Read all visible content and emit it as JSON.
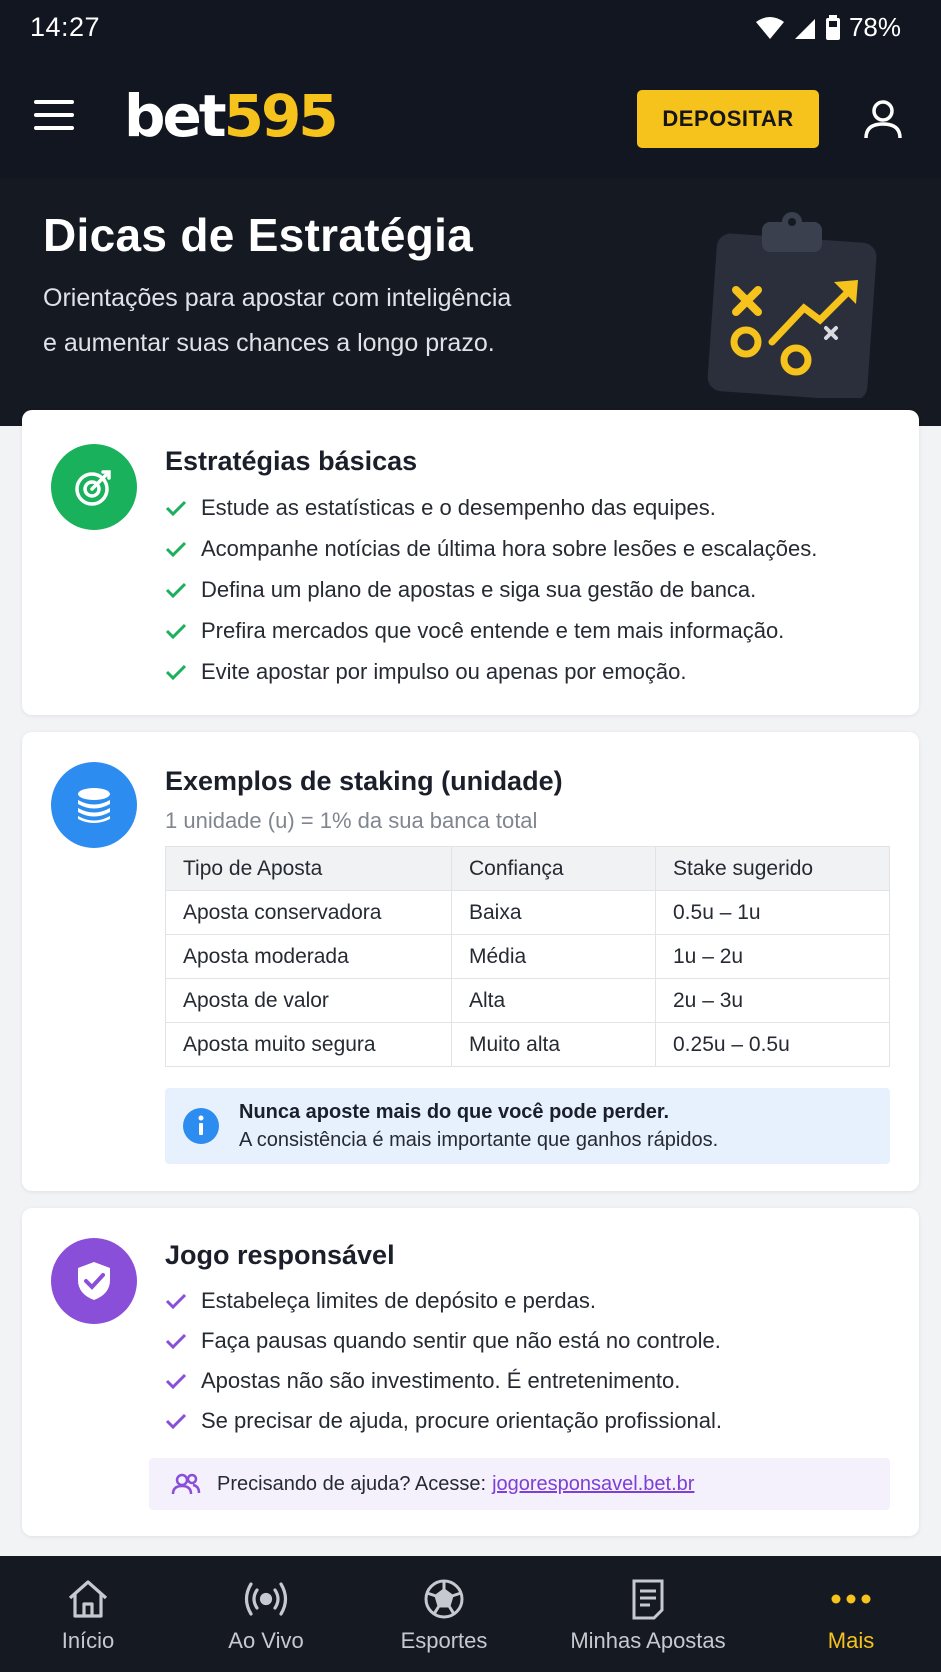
{
  "status_bar": {
    "time": "14:27",
    "battery": "78%"
  },
  "header": {
    "logo_part1": "bet",
    "logo_part2": "595",
    "deposit_label": "DEPOSITAR"
  },
  "hero": {
    "title": "Dicas de Estratégia",
    "subtitle_line1": "Orientações para apostar com inteligência",
    "subtitle_line2": "e aumentar suas chances a longo prazo."
  },
  "basics": {
    "title": "Estratégias básicas",
    "items": [
      "Estude as estatísticas e o desempenho das equipes.",
      "Acompanhe notícias de última hora sobre lesões e escalações.",
      "Defina um plano de apostas e siga sua gestão de banca.",
      "Prefira mercados que você entende e tem mais informação.",
      "Evite apostar por impulso ou apenas por emoção."
    ]
  },
  "staking": {
    "title": "Exemplos de staking (unidade)",
    "subtitle": "1 unidade (u) = 1% da sua banca total",
    "headers": [
      "Tipo de Aposta",
      "Confiança",
      "Stake sugerido"
    ],
    "rows": [
      [
        "Aposta conservadora",
        "Baixa",
        "0.5u – 1u"
      ],
      [
        "Aposta moderada",
        "Média",
        "1u – 2u"
      ],
      [
        "Aposta de valor",
        "Alta",
        "2u – 3u"
      ],
      [
        "Aposta muito segura",
        "Muito alta",
        "0.25u – 0.5u"
      ]
    ],
    "note_title": "Nunca aposte mais do que você pode perder.",
    "note_text": "A consistência é mais importante que ganhos rápidos."
  },
  "responsible": {
    "title": "Jogo responsável",
    "items": [
      "Estabeleça limites de depósito e perdas.",
      "Faça pausas quando sentir que não está no controle.",
      "Apostas não são investimento. É entretenimento.",
      "Se precisar de ajuda, procure orientação profissional."
    ],
    "help_text": "Precisando de ajuda? Acesse:",
    "help_link": "jogoresponsavel.bet.br"
  },
  "nav": {
    "home": "Início",
    "live": "Ao Vivo",
    "sports": "Esportes",
    "bets": "Minhas Apostas",
    "more": "Mais"
  },
  "colors": {
    "brand_yellow": "#f6c21c",
    "dark": "#121620",
    "green": "#19b15b",
    "blue": "#2d8cf0",
    "purple": "#8a4fd8"
  },
  "icons": [
    "menu-icon",
    "user-icon",
    "clipboard-strategy-icon",
    "target-icon",
    "coins-icon",
    "shield-check-icon",
    "info-icon",
    "people-icon",
    "home-icon",
    "live-icon",
    "soccer-ball-icon",
    "bet-slip-icon",
    "more-dots-icon"
  ]
}
